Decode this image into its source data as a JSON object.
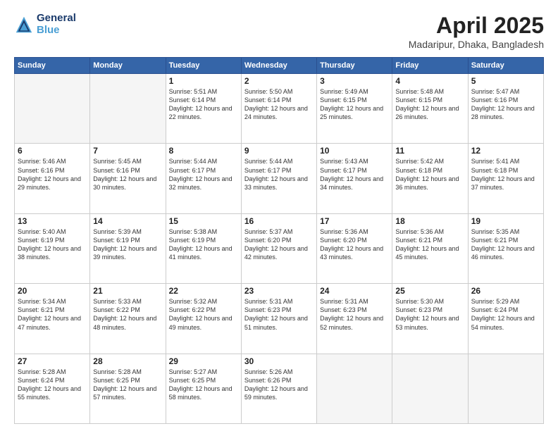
{
  "header": {
    "logo_line1": "General",
    "logo_line2": "Blue",
    "title": "April 2025",
    "subtitle": "Madaripur, Dhaka, Bangladesh"
  },
  "days_of_week": [
    "Sunday",
    "Monday",
    "Tuesday",
    "Wednesday",
    "Thursday",
    "Friday",
    "Saturday"
  ],
  "weeks": [
    [
      {
        "day": "",
        "info": ""
      },
      {
        "day": "",
        "info": ""
      },
      {
        "day": "1",
        "info": "Sunrise: 5:51 AM\nSunset: 6:14 PM\nDaylight: 12 hours and 22 minutes."
      },
      {
        "day": "2",
        "info": "Sunrise: 5:50 AM\nSunset: 6:14 PM\nDaylight: 12 hours and 24 minutes."
      },
      {
        "day": "3",
        "info": "Sunrise: 5:49 AM\nSunset: 6:15 PM\nDaylight: 12 hours and 25 minutes."
      },
      {
        "day": "4",
        "info": "Sunrise: 5:48 AM\nSunset: 6:15 PM\nDaylight: 12 hours and 26 minutes."
      },
      {
        "day": "5",
        "info": "Sunrise: 5:47 AM\nSunset: 6:16 PM\nDaylight: 12 hours and 28 minutes."
      }
    ],
    [
      {
        "day": "6",
        "info": "Sunrise: 5:46 AM\nSunset: 6:16 PM\nDaylight: 12 hours and 29 minutes."
      },
      {
        "day": "7",
        "info": "Sunrise: 5:45 AM\nSunset: 6:16 PM\nDaylight: 12 hours and 30 minutes."
      },
      {
        "day": "8",
        "info": "Sunrise: 5:44 AM\nSunset: 6:17 PM\nDaylight: 12 hours and 32 minutes."
      },
      {
        "day": "9",
        "info": "Sunrise: 5:44 AM\nSunset: 6:17 PM\nDaylight: 12 hours and 33 minutes."
      },
      {
        "day": "10",
        "info": "Sunrise: 5:43 AM\nSunset: 6:17 PM\nDaylight: 12 hours and 34 minutes."
      },
      {
        "day": "11",
        "info": "Sunrise: 5:42 AM\nSunset: 6:18 PM\nDaylight: 12 hours and 36 minutes."
      },
      {
        "day": "12",
        "info": "Sunrise: 5:41 AM\nSunset: 6:18 PM\nDaylight: 12 hours and 37 minutes."
      }
    ],
    [
      {
        "day": "13",
        "info": "Sunrise: 5:40 AM\nSunset: 6:19 PM\nDaylight: 12 hours and 38 minutes."
      },
      {
        "day": "14",
        "info": "Sunrise: 5:39 AM\nSunset: 6:19 PM\nDaylight: 12 hours and 39 minutes."
      },
      {
        "day": "15",
        "info": "Sunrise: 5:38 AM\nSunset: 6:19 PM\nDaylight: 12 hours and 41 minutes."
      },
      {
        "day": "16",
        "info": "Sunrise: 5:37 AM\nSunset: 6:20 PM\nDaylight: 12 hours and 42 minutes."
      },
      {
        "day": "17",
        "info": "Sunrise: 5:36 AM\nSunset: 6:20 PM\nDaylight: 12 hours and 43 minutes."
      },
      {
        "day": "18",
        "info": "Sunrise: 5:36 AM\nSunset: 6:21 PM\nDaylight: 12 hours and 45 minutes."
      },
      {
        "day": "19",
        "info": "Sunrise: 5:35 AM\nSunset: 6:21 PM\nDaylight: 12 hours and 46 minutes."
      }
    ],
    [
      {
        "day": "20",
        "info": "Sunrise: 5:34 AM\nSunset: 6:21 PM\nDaylight: 12 hours and 47 minutes."
      },
      {
        "day": "21",
        "info": "Sunrise: 5:33 AM\nSunset: 6:22 PM\nDaylight: 12 hours and 48 minutes."
      },
      {
        "day": "22",
        "info": "Sunrise: 5:32 AM\nSunset: 6:22 PM\nDaylight: 12 hours and 49 minutes."
      },
      {
        "day": "23",
        "info": "Sunrise: 5:31 AM\nSunset: 6:23 PM\nDaylight: 12 hours and 51 minutes."
      },
      {
        "day": "24",
        "info": "Sunrise: 5:31 AM\nSunset: 6:23 PM\nDaylight: 12 hours and 52 minutes."
      },
      {
        "day": "25",
        "info": "Sunrise: 5:30 AM\nSunset: 6:23 PM\nDaylight: 12 hours and 53 minutes."
      },
      {
        "day": "26",
        "info": "Sunrise: 5:29 AM\nSunset: 6:24 PM\nDaylight: 12 hours and 54 minutes."
      }
    ],
    [
      {
        "day": "27",
        "info": "Sunrise: 5:28 AM\nSunset: 6:24 PM\nDaylight: 12 hours and 55 minutes."
      },
      {
        "day": "28",
        "info": "Sunrise: 5:28 AM\nSunset: 6:25 PM\nDaylight: 12 hours and 57 minutes."
      },
      {
        "day": "29",
        "info": "Sunrise: 5:27 AM\nSunset: 6:25 PM\nDaylight: 12 hours and 58 minutes."
      },
      {
        "day": "30",
        "info": "Sunrise: 5:26 AM\nSunset: 6:26 PM\nDaylight: 12 hours and 59 minutes."
      },
      {
        "day": "",
        "info": ""
      },
      {
        "day": "",
        "info": ""
      },
      {
        "day": "",
        "info": ""
      }
    ]
  ]
}
